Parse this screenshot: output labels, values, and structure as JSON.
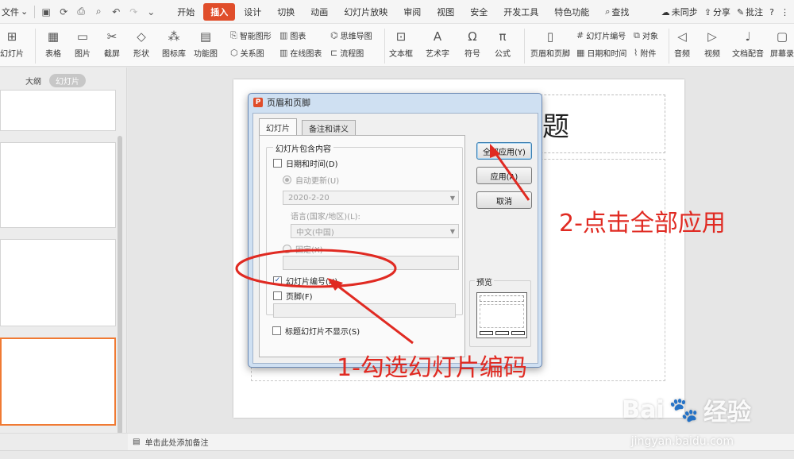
{
  "menubar": {
    "file": "文件",
    "tabs": [
      "开始",
      "插入",
      "设计",
      "切换",
      "动画",
      "幻灯片放映",
      "审阅",
      "视图",
      "安全",
      "开发工具",
      "特色功能"
    ],
    "active_tab": "插入",
    "search": "查找",
    "sync": "未同步",
    "share": "分享",
    "comment": "批注",
    "help": "?",
    "more": "⋮"
  },
  "ribbon": {
    "new_slide": "幻灯片",
    "table": "表格",
    "picture": "图片",
    "screenshot": "截屏",
    "shape": "形状",
    "icon_lib": "图标库",
    "function_chart": "功能图",
    "smart_shape": "智能图形",
    "chart": "图表",
    "mindmap": "思维导图",
    "relation": "关系图",
    "online_chart": "在线图表",
    "flowchart": "流程图",
    "textbox": "文本框",
    "wordart": "艺术字",
    "symbol": "符号",
    "formula": "公式",
    "header_footer": "页眉和页脚",
    "slide_number": "幻灯片编号",
    "object": "对象",
    "datetime": "日期和时间",
    "attachment": "附件",
    "audio": "音频",
    "video": "视频",
    "voiceover": "文档配音",
    "screen_record": "屏幕录"
  },
  "left_pane": {
    "outline_tab": "大纲",
    "slides_tab": "幻灯片"
  },
  "slide": {
    "title_fragment": "题"
  },
  "notes": {
    "placeholder": "单击此处添加备注"
  },
  "dialog": {
    "title": "页眉和页脚",
    "tab_slide": "幻灯片",
    "tab_notes": "备注和讲义",
    "group_label": "幻灯片包含内容",
    "date_time_label": "日期和时间(D)",
    "auto_update_label": "自动更新(U)",
    "date_value": "2020-2-20",
    "language_label": "语言(国家/地区)(L):",
    "language_value": "中文(中国)",
    "fixed_label": "固定(X)",
    "slide_number_label": "幻灯片编号(N)",
    "slide_number_checked": true,
    "footer_label": "页脚(F)",
    "hide_title_label": "标题幻灯片不显示(S)",
    "apply_all": "全部应用(Y)",
    "apply": "应用(A)",
    "cancel": "取消",
    "preview_label": "预览"
  },
  "annotations": {
    "step1": "1-勾选幻灯片编码",
    "step2": "2-点击全部应用",
    "color": "#e02a22"
  },
  "watermark": {
    "brand": "Bai",
    "brand_suffix": "经验",
    "url": "jingyan.baidu.com"
  }
}
